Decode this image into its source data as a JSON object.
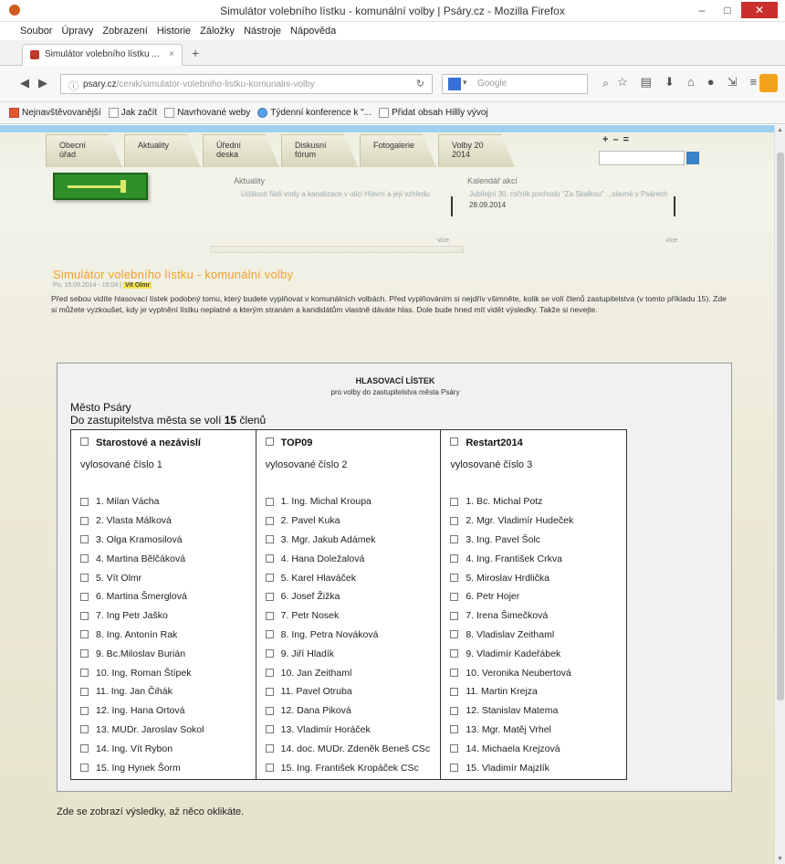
{
  "window": {
    "title": "Simulátor volebního lístku - komunální volby | Psáry.cz - Mozilla Firefox",
    "controls": {
      "minimize": "–",
      "maximize": "□",
      "close": "✕"
    }
  },
  "menu": [
    "Soubor",
    "Úpravy",
    "Zobrazení",
    "Historie",
    "Záložky",
    "Nástroje",
    "Nápověda"
  ],
  "tab": {
    "label": "Simulátor volebního lístku ...",
    "close": "×",
    "new": "+"
  },
  "nav": {
    "url_host": "psary.cz",
    "url_path": "/cenik/simulator-volebniho-listku-komunalni-volby",
    "search_placeholder": "Google"
  },
  "bookmarks": [
    "Nejnavštěvovanější",
    "Jak začít",
    "Navrhované weby",
    "Týdenní konference k \"...",
    "Přidat obsah Hillly vývoj"
  ],
  "site": {
    "tabs": [
      "Obecní\núřad",
      "Aktuality",
      "Úřední\ndeska",
      "Diskusní\nfórum",
      "Fotogalerie",
      "Volby 20\n2014"
    ],
    "font_size_controls": "+ – ="
  },
  "news": {
    "heading": "Aktuality",
    "item": "Události řádí vody a kanalizace v ulici Hlavní a její vzhledu",
    "more": "více"
  },
  "calendar": {
    "heading": "Kalendář akcí",
    "item": "Jubilejní 30. ročník pochodu \"Za Skalkou\" ...slavné v Psárech",
    "date": "28.09.2014",
    "more": "více"
  },
  "article": {
    "title": "Simulátor volebního lístku - komunální volby",
    "meta": "Po, 15.09.2014 - 15:04 |",
    "author": "Vít Olmr",
    "text": "Před sebou vidíte hlasovací lístek podobný tomu, který budete vyplňovat v komunálních volbách. Před vyplňováním si nejdřív všimněte, kolik se volí členů zastupitelstva (v tomto příkladu 15). Zde si můžete vyzkoušet, kdy je vyplnění lístku neplatné a kterým stranám a kandidátům vlastně dáváte hlas. Dole bude hned mít vidět výsledky. Takže si nevejte."
  },
  "ballot": {
    "title": "HLASOVACÍ LÍSTEK",
    "subtitle": "pro volby do zastupitelstva města Psáry",
    "city": "Město Psáry",
    "seats_prefix": "Do zastupitelstva města se volí",
    "seats_count": "15",
    "seats_suffix": "členů",
    "parties": [
      {
        "name": "Starostové a nezávislí",
        "number": "vylosované číslo 1",
        "candidates": [
          "1. Milan Vácha",
          "2. Vlasta Málková",
          "3. Olga Kramosilová",
          "4. Martina Bělčáková",
          "5. Vít Olmr",
          "6. Martina Šmerglová",
          "7. Ing Petr Jaško",
          "8. Ing. Antonín Rak",
          "9. Bc.Miloslav Burián",
          "10. Ing. Roman Štípek",
          "11. Ing. Jan Čihák",
          "12. Ing. Hana Ortová",
          "13. MUDr. Jaroslav Sokol",
          "14. Ing. Vít Rybon",
          "15. Ing Hynek Šorm"
        ]
      },
      {
        "name": "TOP09",
        "number": "vylosované číslo 2",
        "candidates": [
          "1. Ing. Michal Kroupa",
          "2. Pavel Kuka",
          "3. Mgr. Jakub Adámek",
          "4. Hana Doležalová",
          "5. Karel Hlaváček",
          "6. Josef Žižka",
          "7. Petr Nosek",
          "8. Ing. Petra Nováková",
          "9. Jiří Hladík",
          "10. Jan Zeithaml",
          "11. Pavel Otruba",
          "12. Dana Piková",
          "13. Vladimír Horáček",
          "14. doc. MUDr. Zdeněk Beneš CSc",
          "15. Ing. František Kropáček CSc"
        ]
      },
      {
        "name": "Restart2014",
        "number": "vylosované číslo 3",
        "candidates": [
          "1. Bc. Michal Potz",
          "2. Mgr. Vladimír Hudeček",
          "3. Ing. Pavel Šolc",
          "4. Ing. František Crkva",
          "5. Miroslav Hrdlička",
          "6. Petr Hojer",
          "7. Irena Šimečková",
          "8. Vladislav Zeithaml",
          "9. Vladimír Kadeřábek",
          "10. Veronika Neubertová",
          "11. Martin Krejza",
          "12. Stanislav Matema",
          "13. Mgr. Matěj Vrhel",
          "14. Michaela Krejzová",
          "15. Vladimír Majzlík"
        ]
      }
    ],
    "results_text": "Zde se zobrazí výsledky, až něco oklikáte."
  },
  "colors": {
    "accent_orange": "#f0a12b",
    "logo_green": "#2f8f2a",
    "header_blue": "#9ed0ef"
  }
}
